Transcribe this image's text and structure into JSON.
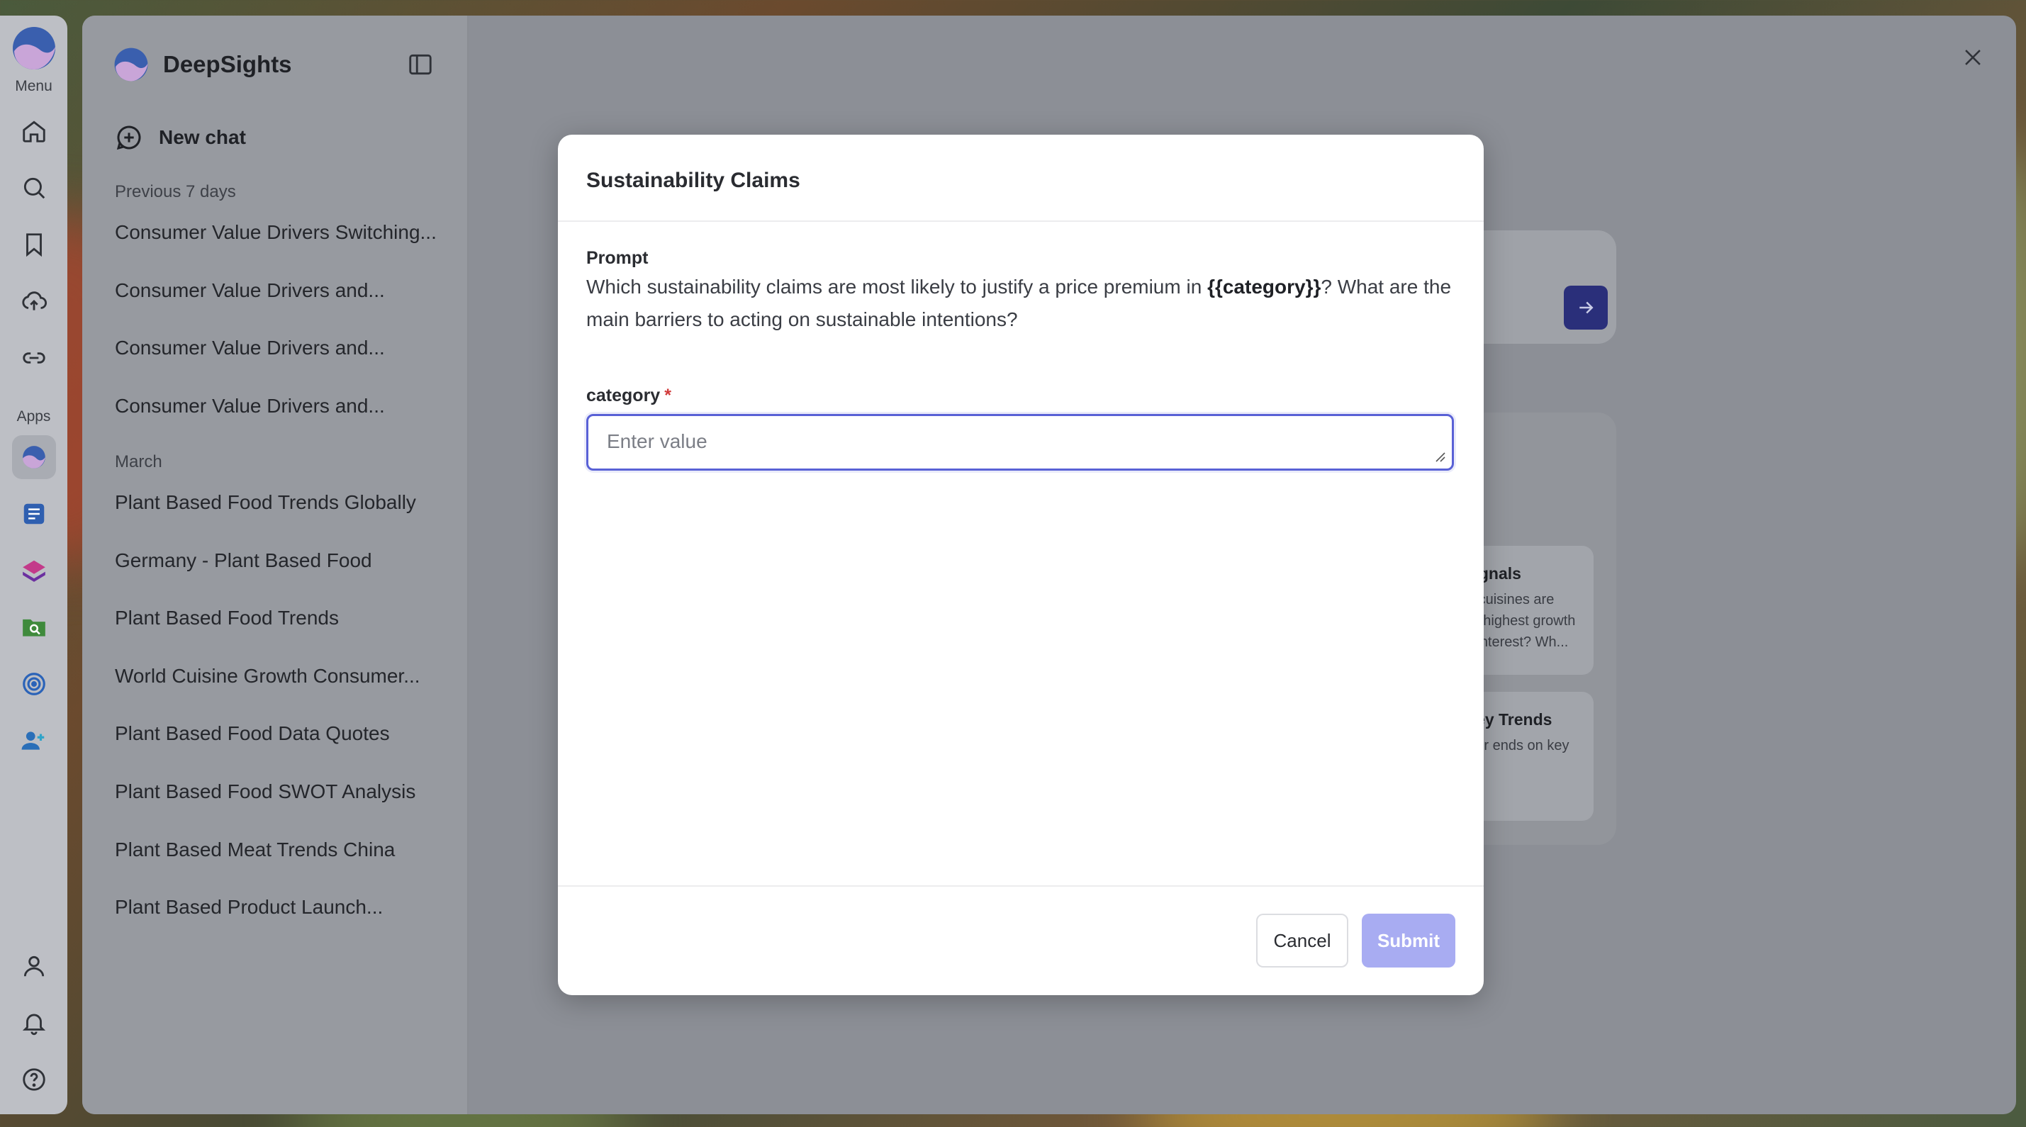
{
  "rail": {
    "menu_label": "Menu",
    "apps_label": "Apps"
  },
  "sidebar": {
    "title": "DeepSights",
    "new_chat": "New chat",
    "sections": [
      {
        "label": "Previous 7 days",
        "items": [
          "Consumer Value Drivers Switching...",
          "Consumer Value Drivers and...",
          "Consumer Value Drivers and...",
          "Consumer Value Drivers and..."
        ]
      },
      {
        "label": "March",
        "items": [
          "Plant Based Food Trends Globally",
          "Germany - Plant Based Food",
          "Plant Based Food Trends",
          "World Cuisine Growth Consumer...",
          "Plant Based Food Data Quotes",
          "Plant Based Food SWOT Analysis",
          "Plant Based Meat Trends China",
          "Plant Based Product Launch..."
        ]
      }
    ]
  },
  "background": {
    "question_mark": "?",
    "cards": [
      {
        "title": "lentify Signals",
        "text": "hich world cuisines are howing the highest growth consumer interest? Wh..."
      },
      {
        "title": "xplore Key Trends",
        "text": "xplore major ends on key topic"
      }
    ]
  },
  "modal": {
    "title": "Sustainability Claims",
    "prompt_label": "Prompt",
    "prompt_before": "Which sustainability claims are most likely to justify a price premium in ",
    "prompt_variable": "{{category}}",
    "prompt_after": "? What are the main barriers to acting on sustainable intentions?",
    "field_label": "category",
    "field_required": "*",
    "field_placeholder": "Enter value",
    "field_value": "",
    "cancel_label": "Cancel",
    "submit_label": "Submit"
  },
  "colors": {
    "accent": "#5961d6",
    "submit_disabled": "#a8acf2",
    "send_button": "#2a2f7a",
    "required": "#d13b3b"
  },
  "icons": [
    "deepsights-logo-icon",
    "home-icon",
    "search-icon",
    "bookmark-icon",
    "upload-icon",
    "link-icon",
    "deepsights-app-icon",
    "document-app-icon",
    "layers-app-icon",
    "folder-search-app-icon",
    "radar-app-icon",
    "users-app-icon",
    "user-icon",
    "bell-icon",
    "help-icon",
    "sidebar-toggle-icon",
    "new-chat-icon",
    "close-icon",
    "arrow-right-icon",
    "resize-grip-icon"
  ]
}
